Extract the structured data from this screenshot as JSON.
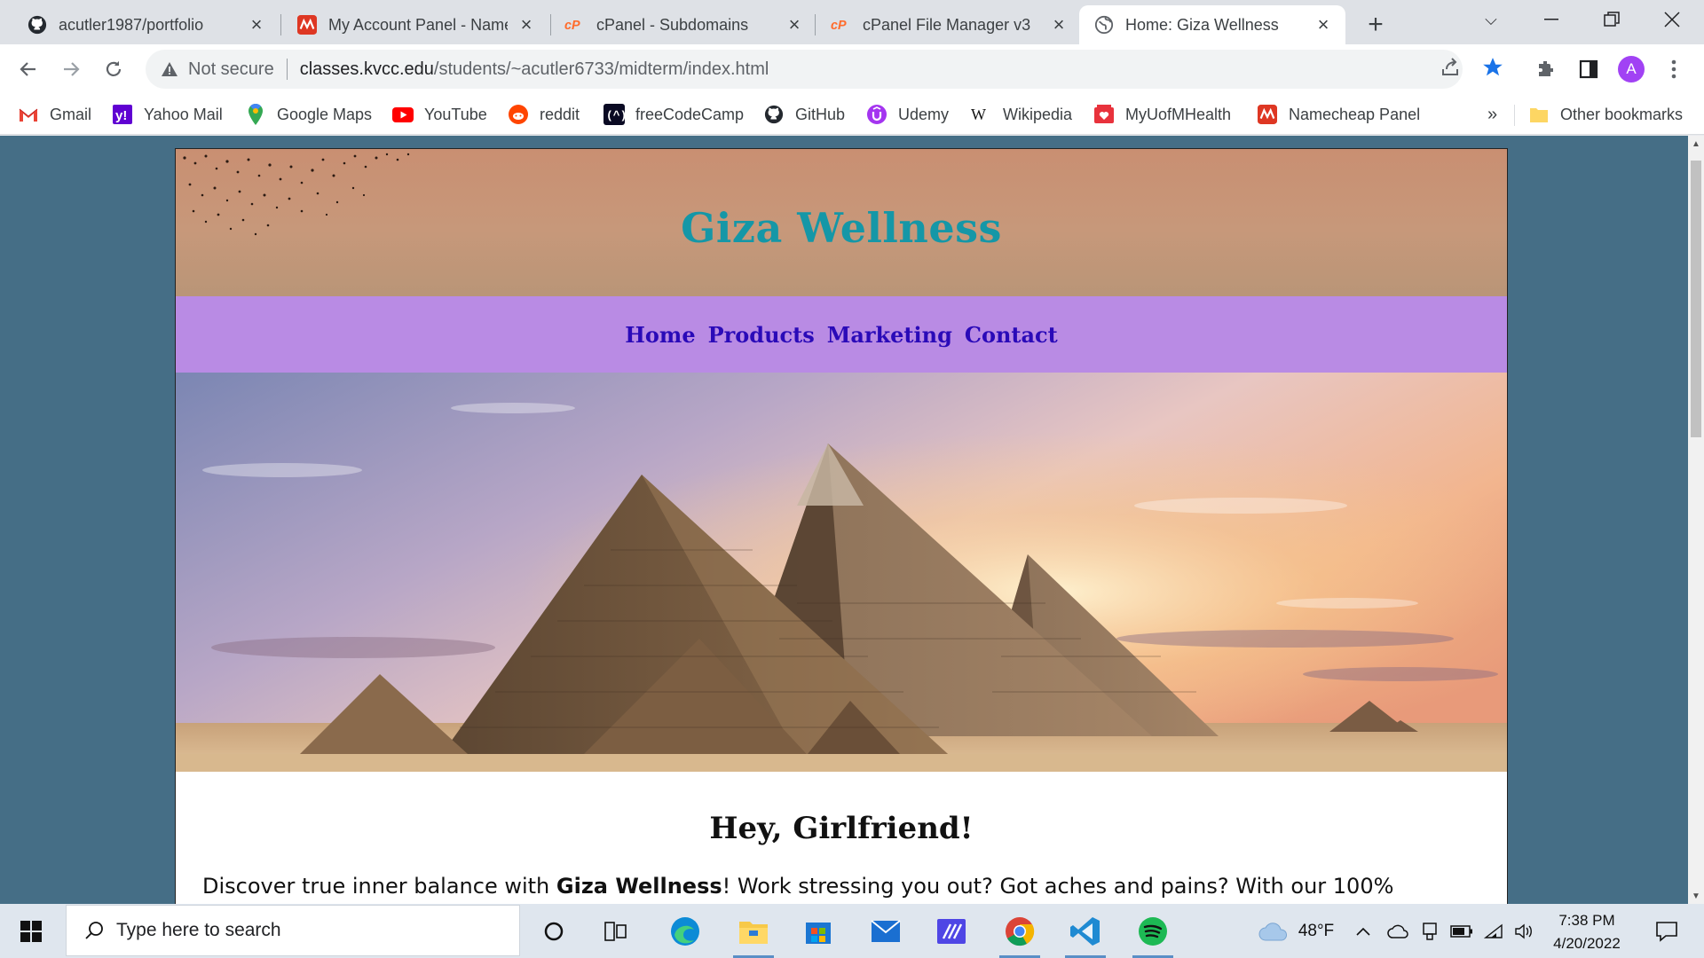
{
  "browser": {
    "tabs": [
      {
        "title": "acutler1987/portfolio",
        "icon": "github-icon",
        "active": false
      },
      {
        "title": "My Account Panel - Namecheap",
        "icon": "namecheap-icon",
        "active": false
      },
      {
        "title": "cPanel - Subdomains",
        "icon": "cpanel-icon",
        "active": false
      },
      {
        "title": "cPanel File Manager v3",
        "icon": "cpanel-icon",
        "active": false
      },
      {
        "title": "Home: Giza Wellness",
        "icon": "globe-icon",
        "active": true
      }
    ],
    "security_label": "Not secure",
    "url_host": "classes.kvcc.edu",
    "url_path": "/students/~acutler6733/midterm/index.html",
    "profile_initial": "A",
    "bookmarks": [
      {
        "label": "Gmail",
        "icon": "gmail-icon"
      },
      {
        "label": "Yahoo Mail",
        "icon": "yahoo-icon"
      },
      {
        "label": "Google Maps",
        "icon": "maps-icon"
      },
      {
        "label": "YouTube",
        "icon": "youtube-icon"
      },
      {
        "label": "reddit",
        "icon": "reddit-icon"
      },
      {
        "label": "freeCodeCamp",
        "icon": "freecodecamp-icon"
      },
      {
        "label": "GitHub",
        "icon": "github-icon"
      },
      {
        "label": "Udemy",
        "icon": "udemy-icon"
      },
      {
        "label": "Wikipedia",
        "icon": "wikipedia-icon"
      },
      {
        "label": "MyUofMHealth",
        "icon": "health-icon"
      },
      {
        "label": "Namecheap Panel",
        "icon": "namecheap-icon"
      }
    ],
    "overflow_label": "»",
    "other_bookmarks": "Other bookmarks"
  },
  "site": {
    "title": "Giza Wellness",
    "nav": [
      "Home",
      "Products",
      "Marketing",
      "Contact"
    ],
    "heading": "Hey, Girlfriend!",
    "intro_before": "Discover true inner balance with ",
    "intro_bold": "Giza Wellness",
    "intro_after": "! Work stressing you out? Got aches and pains? With our 100%"
  },
  "taskbar": {
    "search_placeholder": "Type here to search",
    "weather": "48°F",
    "time": "7:38 PM",
    "date": "4/20/2022"
  },
  "colors": {
    "page_background": "#456e86",
    "site_title": "#1597a7",
    "nav_background": "#b98be4",
    "nav_link": "#2a0ab8"
  }
}
